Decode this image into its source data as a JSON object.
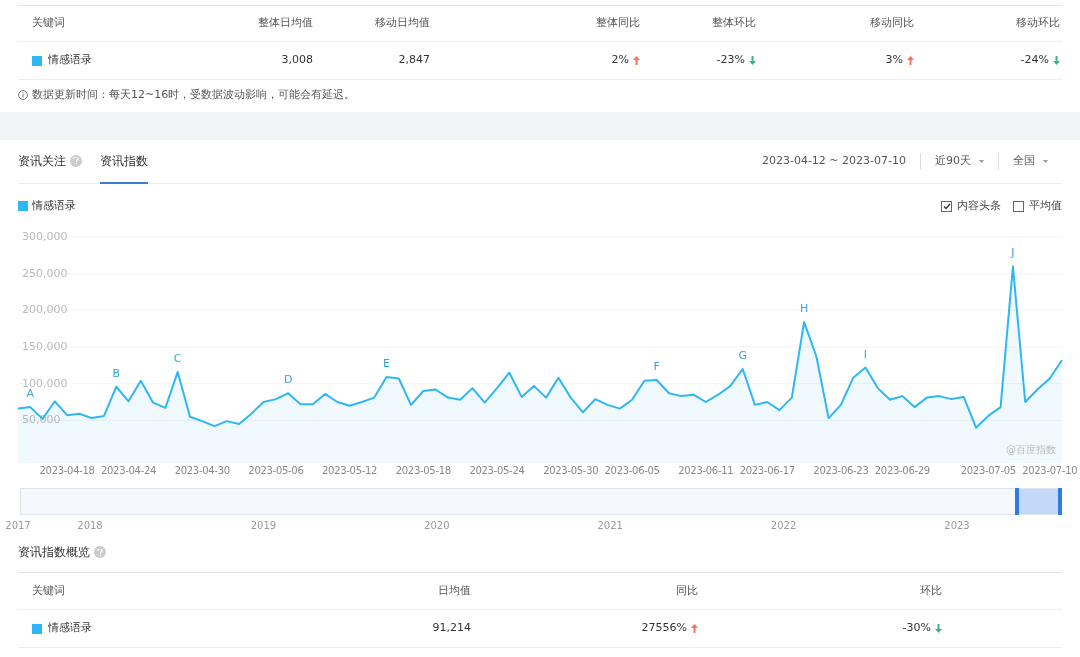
{
  "summary_table": {
    "columns": [
      "关键词",
      "整体日均值",
      "移动日均值",
      "整体同比",
      "整体环比",
      "移动同比",
      "移动环比"
    ],
    "rows": [
      {
        "color": "#2db7f5",
        "cells": [
          {
            "text": "情感语录"
          },
          {
            "text": "3,008"
          },
          {
            "text": "2,847"
          },
          {
            "text": "2%",
            "up": true
          },
          {
            "text": "-23%",
            "up": false
          },
          {
            "text": "3%",
            "up": true
          },
          {
            "text": "-24%",
            "up": false
          }
        ]
      }
    ]
  },
  "note": "数据更新时间：每天12~16时，受数据波动影响，可能会有延迟。",
  "tabs": [
    {
      "label": "资讯关注",
      "help": true,
      "selected": false
    },
    {
      "label": "资讯指数",
      "help": false,
      "selected": true
    }
  ],
  "date_range": "2023-04-12 ~ 2023-07-10",
  "dropdowns": [
    {
      "label": "近90天"
    },
    {
      "label": "全国"
    }
  ],
  "options": [
    {
      "label": "内容头条",
      "checked": true
    },
    {
      "label": "平均值",
      "checked": false
    }
  ],
  "chart_source": "@百度指数",
  "chart_data": {
    "type": "area",
    "grid": true,
    "ylim": [
      0,
      300000
    ],
    "yticks": [
      {
        "value": 50000,
        "label": "50,000"
      },
      {
        "value": 100000,
        "label": "100,000"
      },
      {
        "value": 150000,
        "label": "150,000"
      },
      {
        "value": 200000,
        "label": "200,000"
      },
      {
        "value": 250000,
        "label": "250,000"
      },
      {
        "value": 300000,
        "label": "300,000"
      }
    ],
    "categories": [
      null,
      null,
      null,
      null,
      "2023-04-18",
      null,
      null,
      null,
      null,
      "2023-04-24",
      null,
      null,
      null,
      null,
      null,
      "2023-04-30",
      null,
      null,
      null,
      null,
      null,
      "2023-05-06",
      null,
      null,
      null,
      null,
      null,
      "2023-05-12",
      null,
      null,
      null,
      null,
      null,
      "2023-05-18",
      null,
      null,
      null,
      null,
      null,
      "2023-05-24",
      null,
      null,
      null,
      null,
      null,
      "2023-05-30",
      null,
      null,
      null,
      null,
      "2023-06-05",
      null,
      null,
      null,
      null,
      null,
      "2023-06-11",
      null,
      null,
      null,
      null,
      "2023-06-17",
      null,
      null,
      null,
      null,
      null,
      "2023-06-23",
      null,
      null,
      null,
      null,
      "2023-06-29",
      null,
      null,
      null,
      null,
      null,
      null,
      "2023-07-05",
      null,
      null,
      null,
      null,
      "2023-07-10",
      null
    ],
    "series": [
      {
        "name": "情感语录",
        "color": "#2db7f5",
        "values": [
          66000,
          68000,
          52000,
          76000,
          57000,
          59000,
          53000,
          56000,
          96000,
          76000,
          104000,
          74000,
          67000,
          116000,
          55000,
          49000,
          42000,
          49000,
          45000,
          59000,
          75000,
          79000,
          87000,
          72000,
          72000,
          86000,
          75000,
          70000,
          75000,
          81000,
          109000,
          107000,
          71000,
          90000,
          92000,
          81000,
          78000,
          94000,
          74000,
          94000,
          115000,
          82000,
          97000,
          81000,
          108000,
          81000,
          61000,
          79000,
          71000,
          66000,
          78000,
          104000,
          105000,
          87000,
          83000,
          85000,
          75000,
          85000,
          97000,
          120000,
          71000,
          75000,
          64000,
          81000,
          184000,
          137000,
          53000,
          71000,
          108000,
          122000,
          94000,
          78000,
          83000,
          68000,
          81000,
          83000,
          79000,
          82000,
          40000,
          56000,
          68000,
          260000,
          75000,
          92000,
          107000,
          132000
        ]
      }
    ],
    "annotations": [
      {
        "y": 68000,
        "text": "A"
      },
      {
        "y": 96000,
        "text": "B"
      },
      {
        "y": 116000,
        "text": "C"
      },
      {
        "y": 87000,
        "text": "D"
      },
      {
        "y": 109000,
        "text": "E"
      },
      {
        "y": 105000,
        "text": "F"
      },
      {
        "y": 120000,
        "text": "G"
      },
      {
        "y": 184000,
        "text": "H"
      },
      {
        "y": 122000,
        "text": "I"
      },
      {
        "y": 260000,
        "text": "J"
      }
    ]
  },
  "timeline_years": [
    "2017",
    "2018",
    "2019",
    "2020",
    "2021",
    "2022",
    "2023"
  ],
  "overview": {
    "title": "资讯指数概览",
    "help": true,
    "columns": [
      "关键词",
      "日均值",
      "同比",
      "环比"
    ],
    "rows": [
      {
        "color": "#2db7f5",
        "cells": [
          {
            "text": "情感语录"
          },
          {
            "text": "91,214"
          },
          {
            "text": "27556%",
            "up": true
          },
          {
            "text": "-30%",
            "up": false
          }
        ]
      }
    ]
  }
}
